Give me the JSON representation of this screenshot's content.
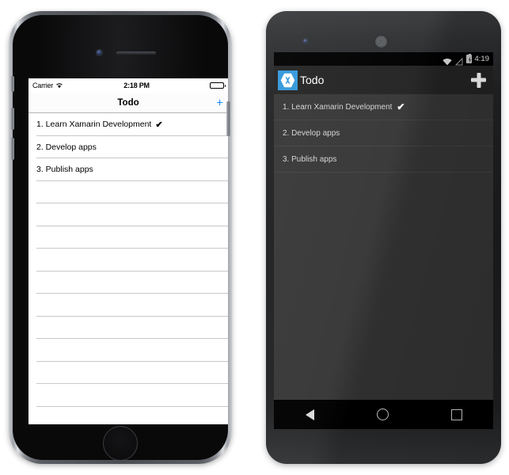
{
  "ios": {
    "status_bar": {
      "carrier": "Carrier",
      "wifi_icon": "wifi-icon",
      "time": "2:18 PM",
      "battery_icon": "battery-full-icon"
    },
    "nav_bar": {
      "title": "Todo",
      "add_label": "+",
      "add_icon": "plus-icon",
      "accent_color": "#1a8cff"
    },
    "list": {
      "items": [
        {
          "text": "1. Learn Xamarin Development",
          "done": true,
          "check": "✔"
        },
        {
          "text": "2. Develop apps",
          "done": false,
          "check": ""
        },
        {
          "text": "3. Publish apps",
          "done": false,
          "check": ""
        }
      ],
      "empty_row_count": 11,
      "separator_color": "#c8c7cc",
      "background_color": "#ffffff"
    }
  },
  "android": {
    "status_bar": {
      "wifi_icon": "wifi-icon",
      "signal_off_icon": "signal-disabled-icon",
      "battery_icon": "battery-charging-icon",
      "time": "4:19"
    },
    "app_bar": {
      "logo_icon": "xamarin-logo-icon",
      "logo_letter": "X",
      "title": "Todo",
      "add_label": "+",
      "add_icon": "plus-icon",
      "background_color": "#242424",
      "logo_background_color": "#3498db"
    },
    "list": {
      "items": [
        {
          "text": "1. Learn Xamarin Development",
          "done": true,
          "check": "✔"
        },
        {
          "text": "2. Develop apps",
          "done": false,
          "check": ""
        },
        {
          "text": "3. Publish apps",
          "done": false,
          "check": ""
        }
      ],
      "background_color": "#373737",
      "separator_color": "#434343",
      "text_color": "#d4d4d4"
    },
    "nav_bar": {
      "back_icon": "back-triangle-icon",
      "home_icon": "home-circle-icon",
      "recents_icon": "recents-square-icon",
      "background_color": "#000000"
    }
  }
}
